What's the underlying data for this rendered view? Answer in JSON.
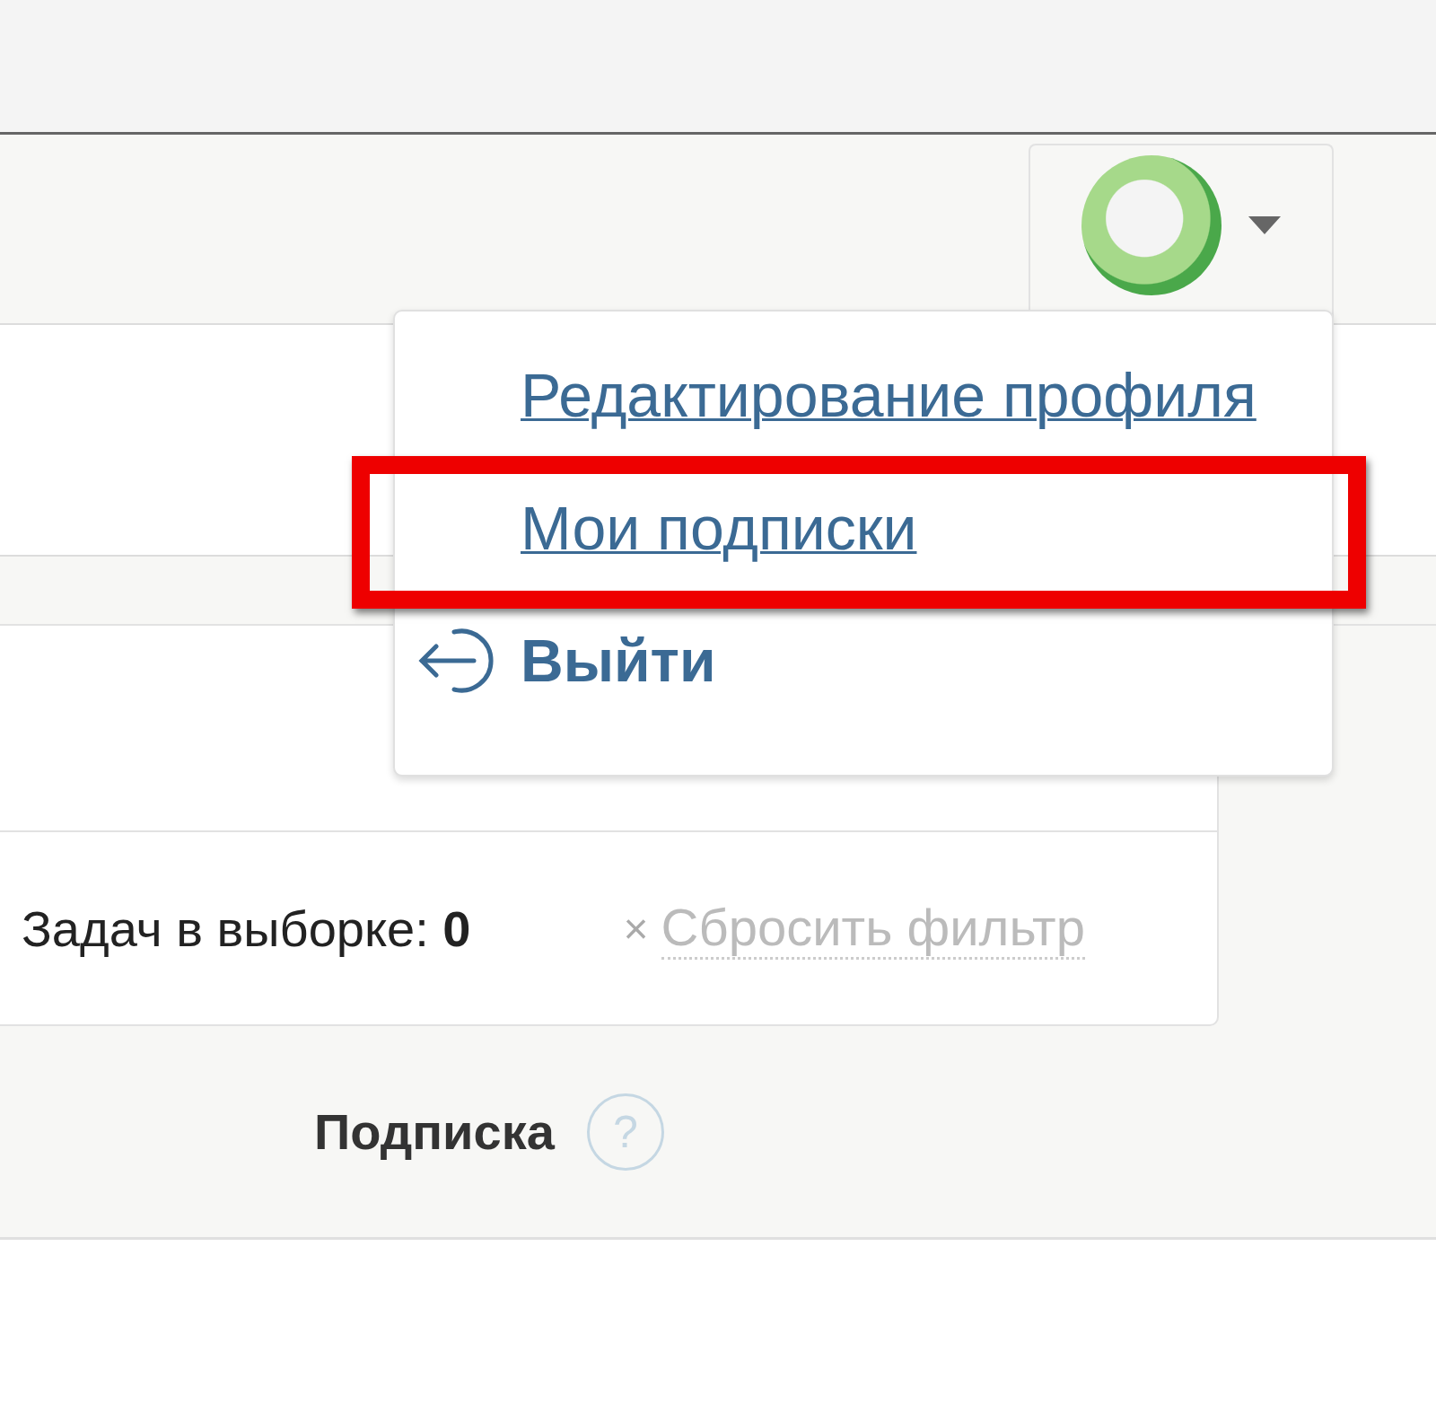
{
  "user_menu": {
    "items": [
      {
        "label": "Редактирование профиля",
        "kind": "link",
        "highlighted": false
      },
      {
        "label": "Мои подписки",
        "kind": "link",
        "highlighted": true
      },
      {
        "label": "Выйти",
        "kind": "logout",
        "highlighted": false
      }
    ]
  },
  "filter": {
    "count_text": "Задач в выборке: **0**",
    "reset_icon": "×",
    "reset_label": "Сбросить фильтр"
  },
  "column_header": {
    "label": "Подписка",
    "help_icon": "?"
  }
}
